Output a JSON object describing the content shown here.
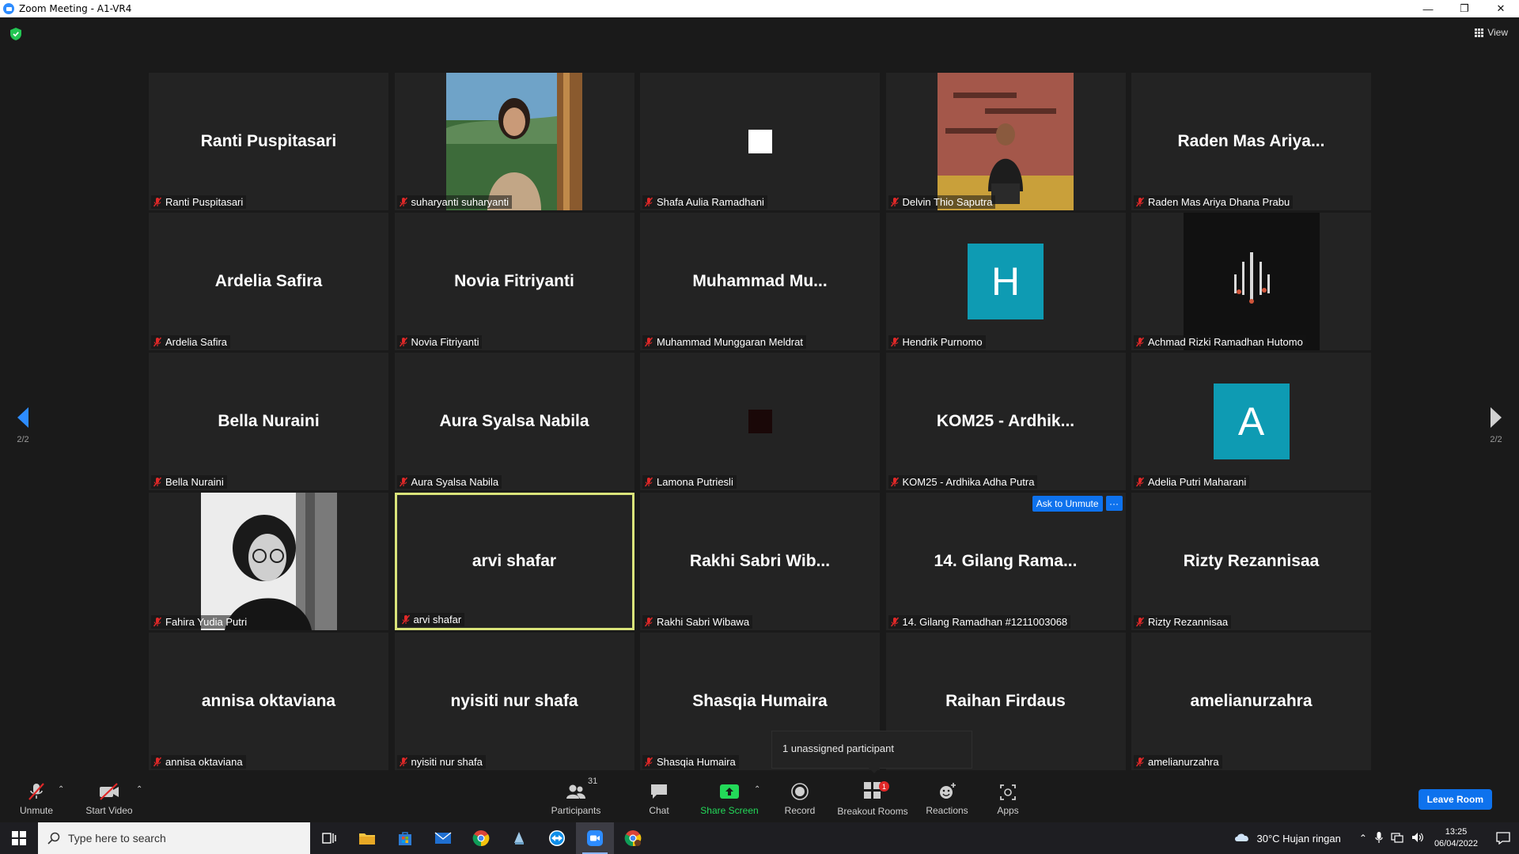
{
  "window": {
    "title": "Zoom Meeting - A1-VR4"
  },
  "header": {
    "view_label": "View"
  },
  "pager": {
    "left": "2/2",
    "right": "2/2"
  },
  "tiles": [
    {
      "display": "Ranti Puspitasari",
      "label": "Ranti Puspitasari",
      "type": "name"
    },
    {
      "display": "",
      "label": "suharyanti suharyanti",
      "type": "photo"
    },
    {
      "display": "",
      "label": "Shafa Aulia Ramadhani",
      "type": "square-white"
    },
    {
      "display": "",
      "label": "Delvin Thio Saputra",
      "type": "photo"
    },
    {
      "display": "Raden Mas Ariya...",
      "label": "Raden Mas Ariya Dhana Prabu",
      "type": "name"
    },
    {
      "display": "Ardelia Safira",
      "label": "Ardelia Safira",
      "type": "name"
    },
    {
      "display": "Novia Fitriyanti",
      "label": "Novia Fitriyanti",
      "type": "name"
    },
    {
      "display": "Muhammad  Mu...",
      "label": "Muhammad Munggaran Meldrat",
      "type": "name"
    },
    {
      "display": "H",
      "label": "Hendrik Purnomo",
      "type": "letter"
    },
    {
      "display": "",
      "label": "Achmad Rizki Ramadhan Hutomo",
      "type": "photo"
    },
    {
      "display": "Bella Nuraini",
      "label": "Bella Nuraini",
      "type": "name"
    },
    {
      "display": "Aura Syalsa Nabila",
      "label": "Aura Syalsa Nabila",
      "type": "name"
    },
    {
      "display": "",
      "label": "Lamona Putriesli",
      "type": "square-dark"
    },
    {
      "display": "KOM25 - Ardhik...",
      "label": "KOM25 - Ardhika Adha Putra",
      "type": "name"
    },
    {
      "display": "A",
      "label": "Adelia Putri Maharani",
      "type": "letter"
    },
    {
      "display": "",
      "label": "Fahira Yudia Putri",
      "type": "photo"
    },
    {
      "display": "arvi shafar",
      "label": "arvi shafar",
      "type": "name"
    },
    {
      "display": "Rakhi Sabri Wib...",
      "label": "Rakhi Sabri Wibawa",
      "type": "name"
    },
    {
      "display": "14. Gilang Rama...",
      "label": "14. Gilang Ramadhan #1211003068",
      "type": "name"
    },
    {
      "display": "Rizty Rezannisaa",
      "label": "Rizty Rezannisaa",
      "type": "name"
    },
    {
      "display": "annisa oktaviana",
      "label": "annisa oktaviana",
      "type": "name"
    },
    {
      "display": "nyisiti nur shafa",
      "label": "nyisiti nur shafa",
      "type": "name"
    },
    {
      "display": "Shasqia Humaira",
      "label": "Shasqia Humaira",
      "type": "name"
    },
    {
      "display": "Raihan Firdaus",
      "label": "",
      "type": "name"
    },
    {
      "display": "amelianurzahra",
      "label": "amelianurzahra",
      "type": "name"
    }
  ],
  "hover_actions": {
    "ask_to_unmute": "Ask to Unmute",
    "more": "···"
  },
  "tooltip": {
    "text": "1 unassigned participant"
  },
  "toolbar": {
    "unmute": "Unmute",
    "start_video": "Start Video",
    "participants": "Participants",
    "participants_count": "31",
    "chat": "Chat",
    "share_screen": "Share Screen",
    "record": "Record",
    "breakout_rooms": "Breakout Rooms",
    "breakout_badge": "1",
    "reactions": "Reactions",
    "apps": "Apps",
    "leave": "Leave Room"
  },
  "taskbar": {
    "search_placeholder": "Type here to search",
    "weather": "30°C  Hujan ringan",
    "time": "13:25",
    "date": "06/04/2022"
  },
  "colors": {
    "accent": "#0e72ed",
    "active_speaker": "#d9e37a",
    "share_green": "#23d959",
    "avatar_teal": "#0e9bb3",
    "muted_red": "#e02828"
  }
}
